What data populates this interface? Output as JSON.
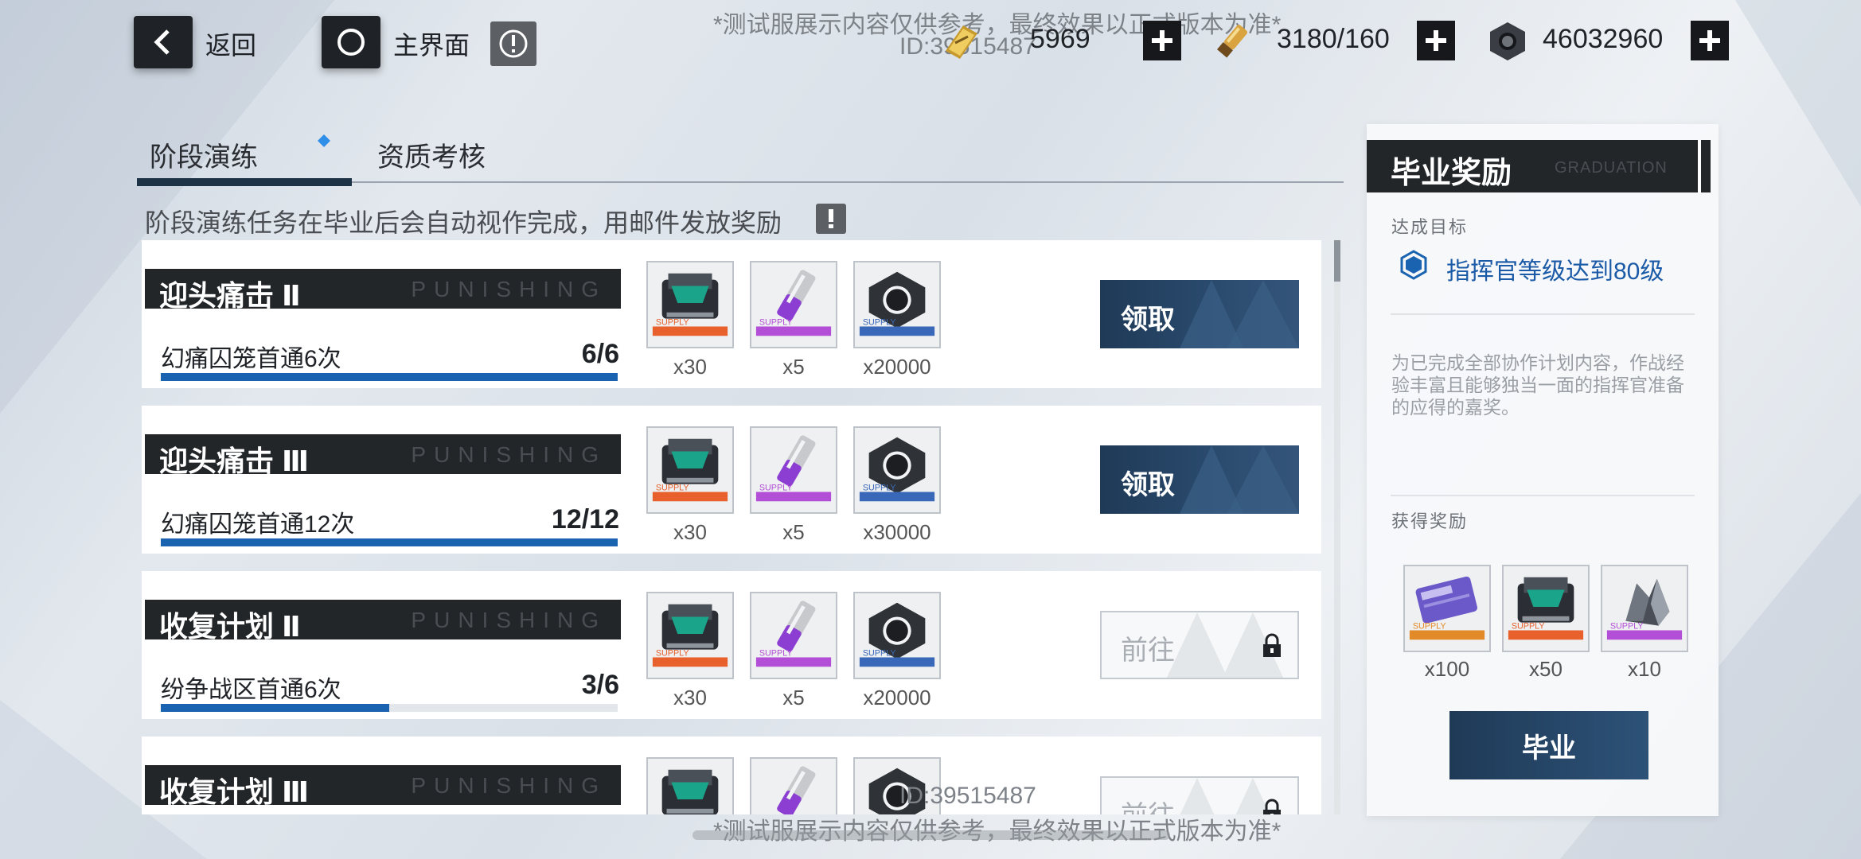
{
  "nav": {
    "back_label": "返回",
    "home_label": "主界面"
  },
  "resources": [
    {
      "icon": "gold-bar-icon",
      "value": "5969"
    },
    {
      "icon": "stamina-cartridge-icon",
      "value": "3180/160"
    },
    {
      "icon": "hex-nut-coin-icon",
      "value": "46032960"
    }
  ],
  "watermark": {
    "top_text": "*测试服展示内容仅供参考，最终效果以正式版本为准*",
    "top_id": "ID:39515487",
    "bottom_id": "ID:39515487",
    "bottom_text": "*测试服展示内容仅供参考，最终效果以正式版本为准*"
  },
  "tabs": [
    {
      "label": "阶段演练"
    },
    {
      "label": "资质考核"
    }
  ],
  "notice": "阶段演练任务在毕业后会自动视作完成，用邮件发放奖励",
  "tasks": [
    {
      "title": "迎头痛击 Ⅱ",
      "deco": "PUNISHING",
      "desc": "幻痛囚笼首通6次",
      "progress": "6/6",
      "progress_ratio": 1.0,
      "rewards": [
        {
          "icon": "supply-chip-icon",
          "qty": "x30"
        },
        {
          "icon": "purple-cartridge-icon",
          "qty": "x5"
        },
        {
          "icon": "hex-nut-icon",
          "qty": "x20000"
        }
      ],
      "action": "领取",
      "action_state": "claim"
    },
    {
      "title": "迎头痛击 Ⅲ",
      "deco": "PUNISHING",
      "desc": "幻痛囚笼首通12次",
      "progress": "12/12",
      "progress_ratio": 1.0,
      "rewards": [
        {
          "icon": "supply-chip-icon",
          "qty": "x30"
        },
        {
          "icon": "purple-cartridge-icon",
          "qty": "x5"
        },
        {
          "icon": "hex-nut-icon",
          "qty": "x30000"
        }
      ],
      "action": "领取",
      "action_state": "claim"
    },
    {
      "title": "收复计划 Ⅱ",
      "deco": "PUNISHING",
      "desc": "纷争战区首通6次",
      "progress": "3/6",
      "progress_ratio": 0.5,
      "rewards": [
        {
          "icon": "supply-chip-icon",
          "qty": "x30"
        },
        {
          "icon": "purple-cartridge-icon",
          "qty": "x5"
        },
        {
          "icon": "hex-nut-icon",
          "qty": "x20000"
        }
      ],
      "action": "前往",
      "action_state": "locked"
    },
    {
      "title": "收复计划 Ⅲ",
      "deco": "PUNISHING",
      "desc": "",
      "progress": "",
      "progress_ratio": 0,
      "rewards": [
        {
          "icon": "supply-chip-icon",
          "qty": ""
        },
        {
          "icon": "purple-cartridge-icon",
          "qty": ""
        },
        {
          "icon": "hex-nut-icon",
          "qty": ""
        }
      ],
      "action": "前往",
      "action_state": "locked"
    }
  ],
  "panel": {
    "title": "毕业奖励",
    "subtitle": "GRADUATION",
    "goal_label": "达成目标",
    "goal": "指挥官等级达到80级",
    "description": "为已完成全部协作计划内容，作战经验丰富且能够独当一面的指挥官准备的应得的嘉奖。",
    "rewards_label": "获得奖励",
    "rewards": [
      {
        "icon": "ticket-card-icon",
        "qty": "x100"
      },
      {
        "icon": "supply-chip-icon",
        "qty": "x50"
      },
      {
        "icon": "crystal-ore-icon",
        "qty": "x10"
      }
    ],
    "button": "毕业"
  },
  "colors": {
    "accent_blue": "#1a63b0",
    "dark": "#232629",
    "button_navy": "#1f3a57",
    "rarity_orange": "#e8612c",
    "rarity_purple": "#b34fd6",
    "rarity_blue": "#3a68b8"
  }
}
